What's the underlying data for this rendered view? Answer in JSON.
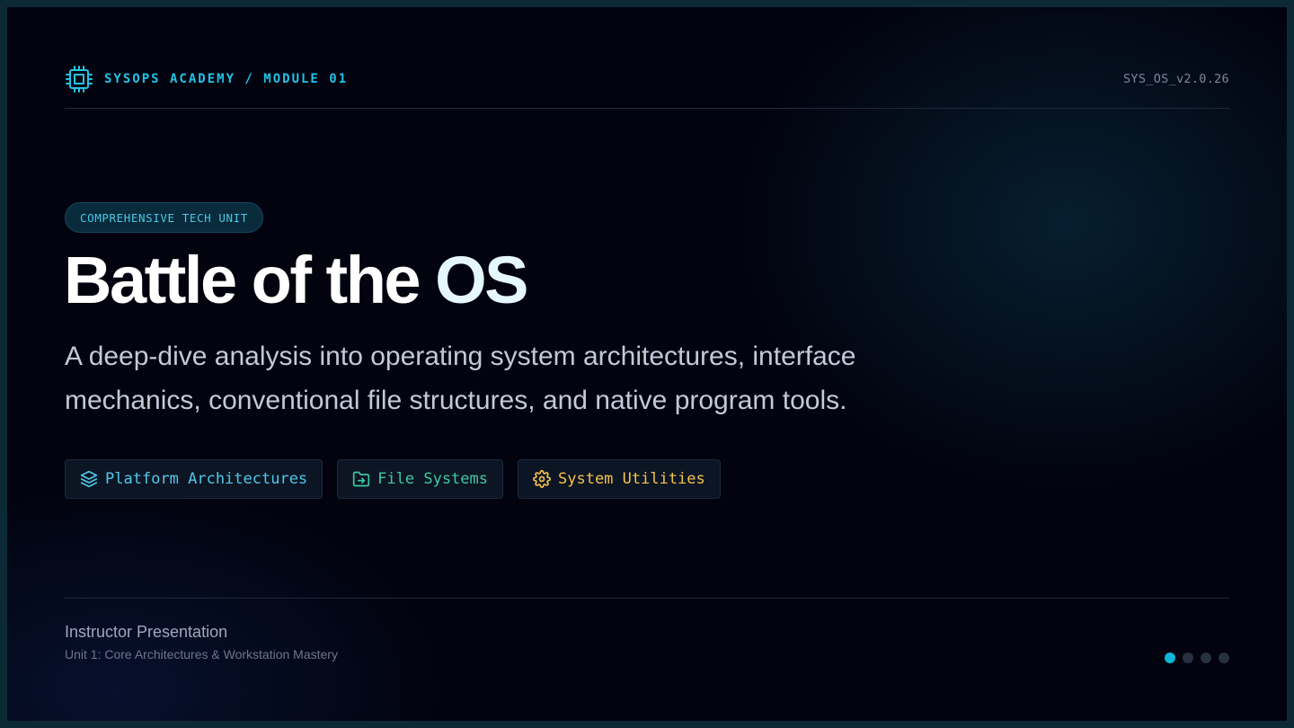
{
  "header": {
    "brand": "SYSOPS ACADEMY / MODULE 01",
    "brand_icon": "cpu-chip-icon",
    "version": "SYS_OS_v2.0.26"
  },
  "badge": "COMPREHENSIVE TECH UNIT",
  "title": {
    "main": "Battle of the ",
    "accent": "OS"
  },
  "subtitle": "A deep-dive analysis into operating system architectures, interface mechanics, conventional file structures, and native program tools.",
  "tags": [
    {
      "label": "Platform Architectures",
      "icon": "layers-icon",
      "color": "#4fc8ea"
    },
    {
      "label": "File Systems",
      "icon": "folder-icon",
      "color": "#3ec9a0"
    },
    {
      "label": "System Utilities",
      "icon": "gear-icon",
      "color": "#f6c24a"
    }
  ],
  "footer": {
    "title": "Instructor Presentation",
    "subtitle": "Unit 1: Core Architectures & Workstation Mastery"
  },
  "pagination": {
    "total": 4,
    "current": 1
  },
  "colors": {
    "accent": "#22c3e6",
    "background": "#02030f",
    "frame": "#0b2a36"
  }
}
